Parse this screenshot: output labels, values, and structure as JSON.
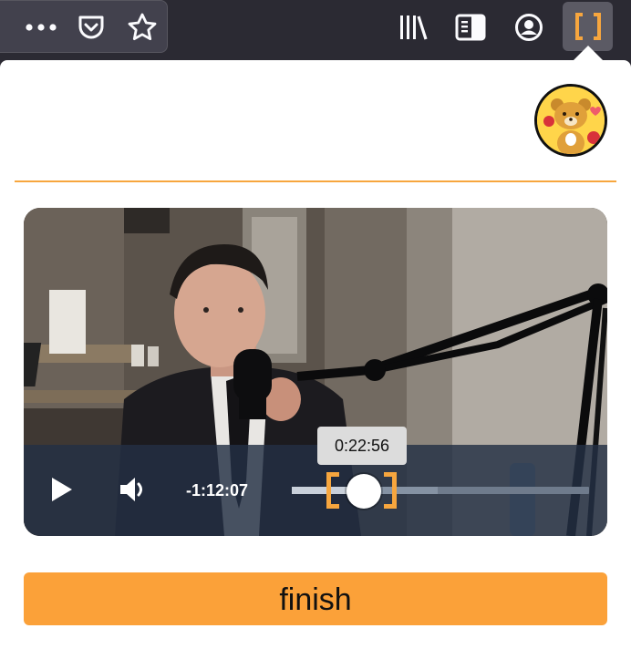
{
  "toolbar": {
    "icons": [
      "more-icon",
      "pocket-icon",
      "bookmark-star-icon",
      "library-icon",
      "sidebar-icon",
      "account-icon",
      "extension-bracket-icon"
    ]
  },
  "colors": {
    "accent": "#f7a63e",
    "finish_button": "#fba139",
    "toolbar_bg": "#2b2a33",
    "player_controls_bg": "#233044"
  },
  "popup": {
    "avatar_icon": "bear-character-avatar",
    "player": {
      "time_remaining": "-1:12:07",
      "hover_time": "0:22:56",
      "progress": 0.25,
      "icons": [
        "play-icon",
        "volume-icon"
      ]
    },
    "finish_label": "finish"
  }
}
